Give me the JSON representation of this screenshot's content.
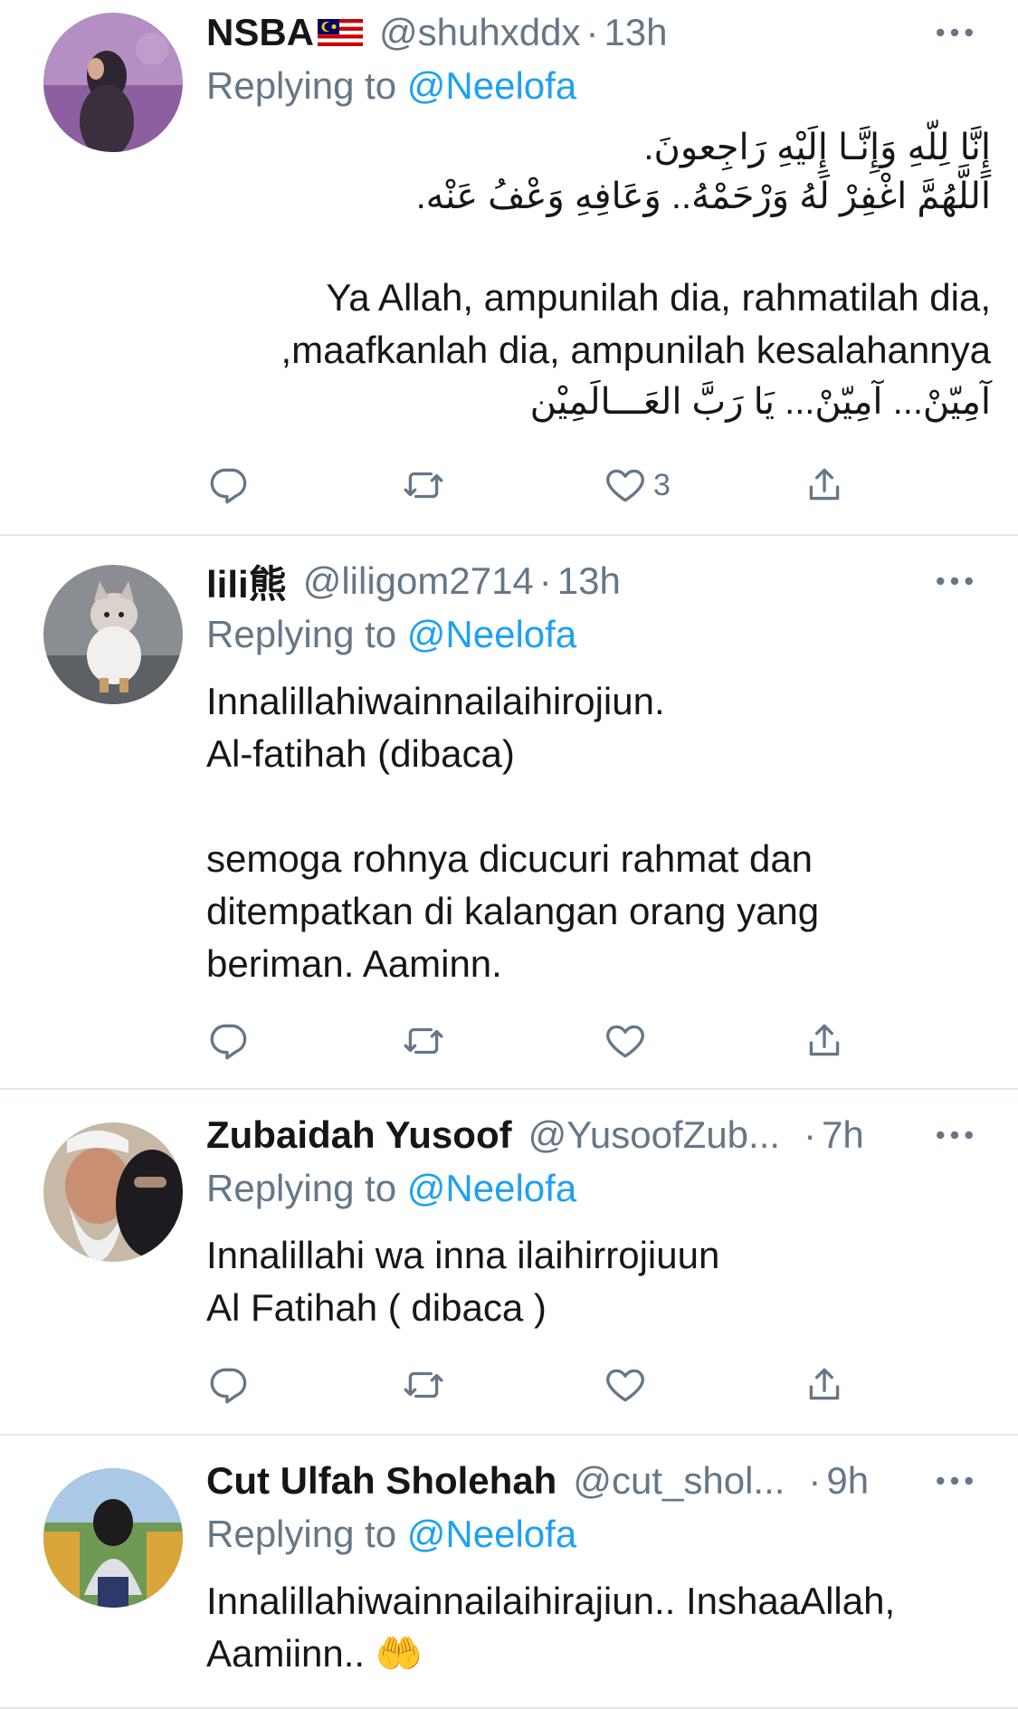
{
  "colors": {
    "link": "#1da1f2",
    "muted": "#657786",
    "text": "#14171a",
    "divider": "#e1e8ed"
  },
  "tweets": [
    {
      "name": "NSBA",
      "flag": "malaysia-flag-icon",
      "handle": "@shuhxddx",
      "dot": "·",
      "time": "13h",
      "replying_prefix": "Replying to",
      "replying_to": "@Neelofa",
      "arabic_line1": "إِنَّا لِلّهِ وَإِنَّـا إِلَيْهِ رَاجِعونَ.",
      "arabic_line2": "اَللَّهُمَّ اغْفِرْ لَهُ وَرْحَمْهُ.. وَعَافِهِ وَعْفُ عَنْه.",
      "text_line1": "Ya Allah, ampunilah dia, rahmatilah dia,",
      "text_line2": ",maafkanlah dia, ampunilah kesalahannya",
      "arabic_line3": "آمِيّنْ... آمِيّنْ... يَا رَبَّ العَـــالَمِيْن",
      "likes": "3"
    },
    {
      "name": "lili熊",
      "handle": "@liligom2714",
      "dot": "·",
      "time": "13h",
      "replying_prefix": "Replying to",
      "replying_to": "@Neelofa",
      "text": "Innalillahiwainnailaihirojiun.\nAl-fatihah (dibaca)\n\nsemoga rohnya dicucuri rahmat dan\nditempatkan di kalangan orang yang\nberiman. Aaminn."
    },
    {
      "name": "Zubaidah Yusoof",
      "handle": "@YusoofZub...",
      "dot": "·",
      "time": "7h",
      "replying_prefix": "Replying to",
      "replying_to": "@Neelofa",
      "text": "Innalillahi wa inna ilaihirrojiuun\nAl Fatihah ( dibaca )"
    },
    {
      "name": "Cut Ulfah Sholehah",
      "handle": "@cut_shol...",
      "dot": "·",
      "time": "9h",
      "replying_prefix": "Replying to",
      "replying_to": "@Neelofa",
      "text": "Innalillahiwainnailaihirajiun.. InshaaAllah,\nAamiinn.. 🤲"
    }
  ]
}
